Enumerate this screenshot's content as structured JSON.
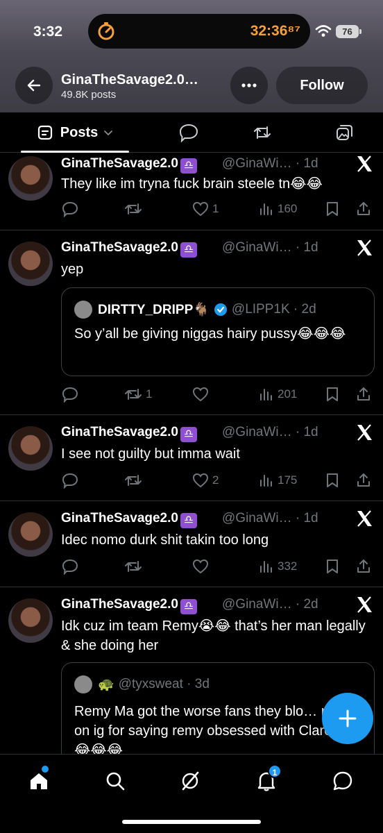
{
  "status_bar": {
    "time": "3:32",
    "timer": "32:36⁸⁷",
    "battery": "76"
  },
  "profile": {
    "name": "GinaTheSavage2.0…",
    "posts": "49.8K posts",
    "follow_label": "Follow"
  },
  "tabs": {
    "posts_label": "Posts"
  },
  "tweets": [
    {
      "name": "GinaTheSavage2.0",
      "handle": "@GinaWi… · 1d",
      "text": "They like im tryna fuck brain steele tn😂😂",
      "replies": "",
      "reposts": "",
      "likes": "1",
      "views": "160"
    },
    {
      "name": "GinaTheSavage2.0",
      "handle": "@GinaWi… · 1d",
      "text": "yep",
      "quote": {
        "name": "DIRTTY_DRIPP🐐",
        "handle": "@LIPP1K · 2d",
        "text": "So y’all be giving niggas hairy pussy😂😂😂"
      },
      "replies": "",
      "reposts": "1",
      "likes": "",
      "views": "201"
    },
    {
      "name": "GinaTheSavage2.0",
      "handle": "@GinaWi… · 1d",
      "text": "I see not guilty but imma wait",
      "replies": "",
      "reposts": "",
      "likes": "2",
      "views": "175"
    },
    {
      "name": "GinaTheSavage2.0",
      "handle": "@GinaWi… · 1d",
      "text": "Idec nomo durk shit takin too long",
      "replies": "",
      "reposts": "",
      "likes": "",
      "views": "332"
    },
    {
      "name": "GinaTheSavage2.0",
      "handle": "@GinaWi… · 2d",
      "text": "Idk cuz im team Remy😭😂 that’s her man legally & she doing her",
      "quote": {
        "name": "🐢",
        "handle": "@tyxsweat · 3d",
        "text": "Remy Ma got the worse fans they blo… me up on ig for saying remy obsessed with Claressa😂😂😂"
      }
    }
  ],
  "badge_symbol": "♎",
  "notifications_count": "1",
  "colors": {
    "accent": "#1d9bf0",
    "badge": "#8e4fd0",
    "muted": "#71767b"
  }
}
